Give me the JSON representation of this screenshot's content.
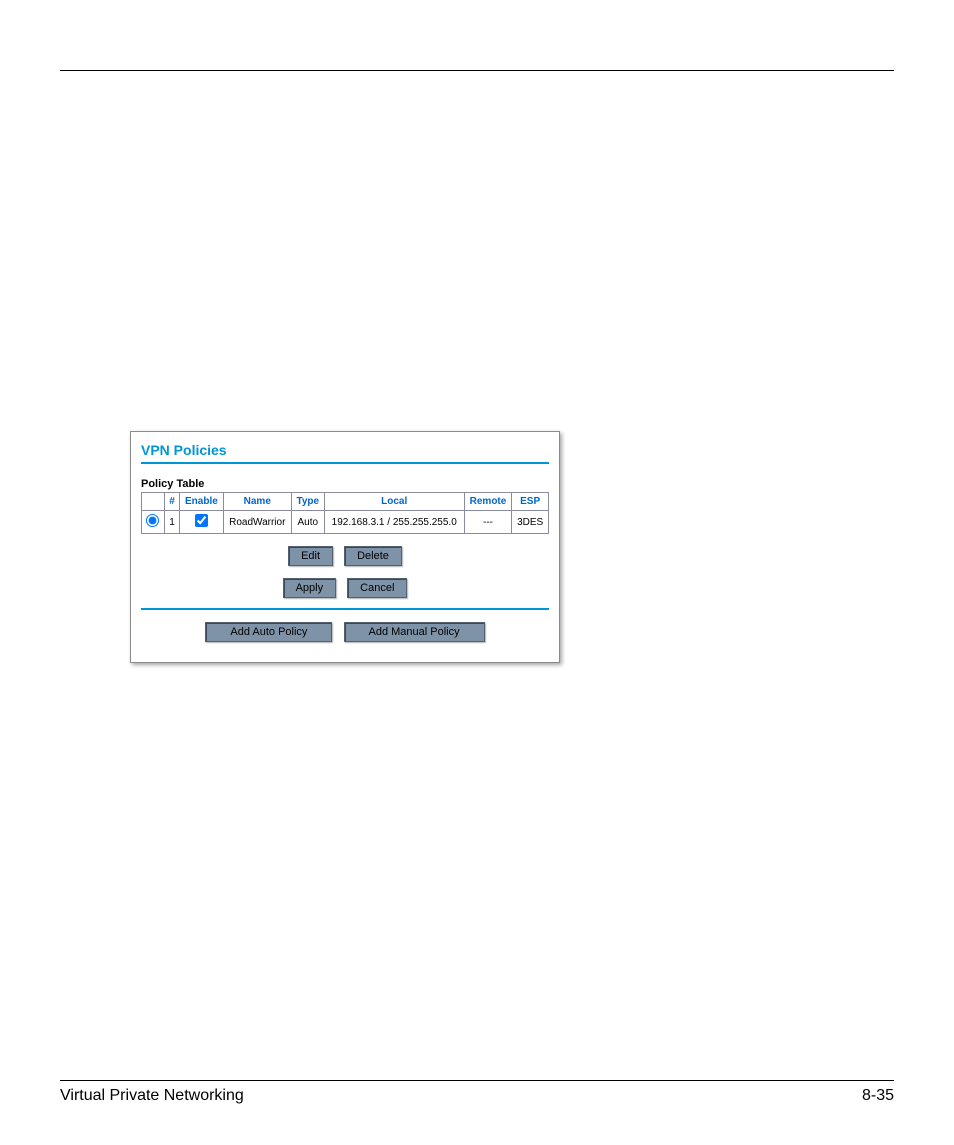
{
  "panel": {
    "title": "VPN Policies",
    "section_label": "Policy Table",
    "headers": {
      "select": "",
      "num": "#",
      "enable": "Enable",
      "name": "Name",
      "type": "Type",
      "local": "Local",
      "remote": "Remote",
      "esp": "ESP"
    },
    "row": {
      "num": "1",
      "name": "RoadWarrior",
      "type": "Auto",
      "local": "192.168.3.1 / 255.255.255.0",
      "remote": "---",
      "esp": "3DES"
    },
    "buttons": {
      "edit": "Edit",
      "delete": "Delete",
      "apply": "Apply",
      "cancel": "Cancel",
      "add_auto": "Add Auto Policy",
      "add_manual": "Add Manual Policy"
    }
  },
  "footer": {
    "left": "Virtual Private Networking",
    "right": "8-35"
  }
}
